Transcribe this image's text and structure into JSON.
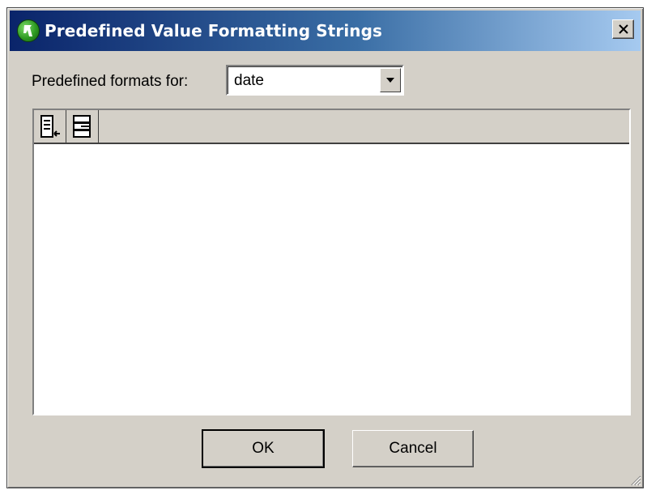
{
  "window": {
    "title": "Predefined Value Formatting Strings",
    "close_symbol": "✕"
  },
  "form": {
    "formats_label": "Predefined formats for:",
    "formats_value": "date"
  },
  "toolbar": {
    "icons": [
      "insert-row-icon",
      "append-row-icon"
    ]
  },
  "list": {
    "items": []
  },
  "buttons": {
    "ok_label": "OK",
    "cancel_label": "Cancel"
  },
  "colors": {
    "titlebar_start": "#0a246a",
    "titlebar_end": "#a6caf0",
    "dialog_face": "#d4d0c8",
    "app_icon_green": "#2e9a22"
  }
}
